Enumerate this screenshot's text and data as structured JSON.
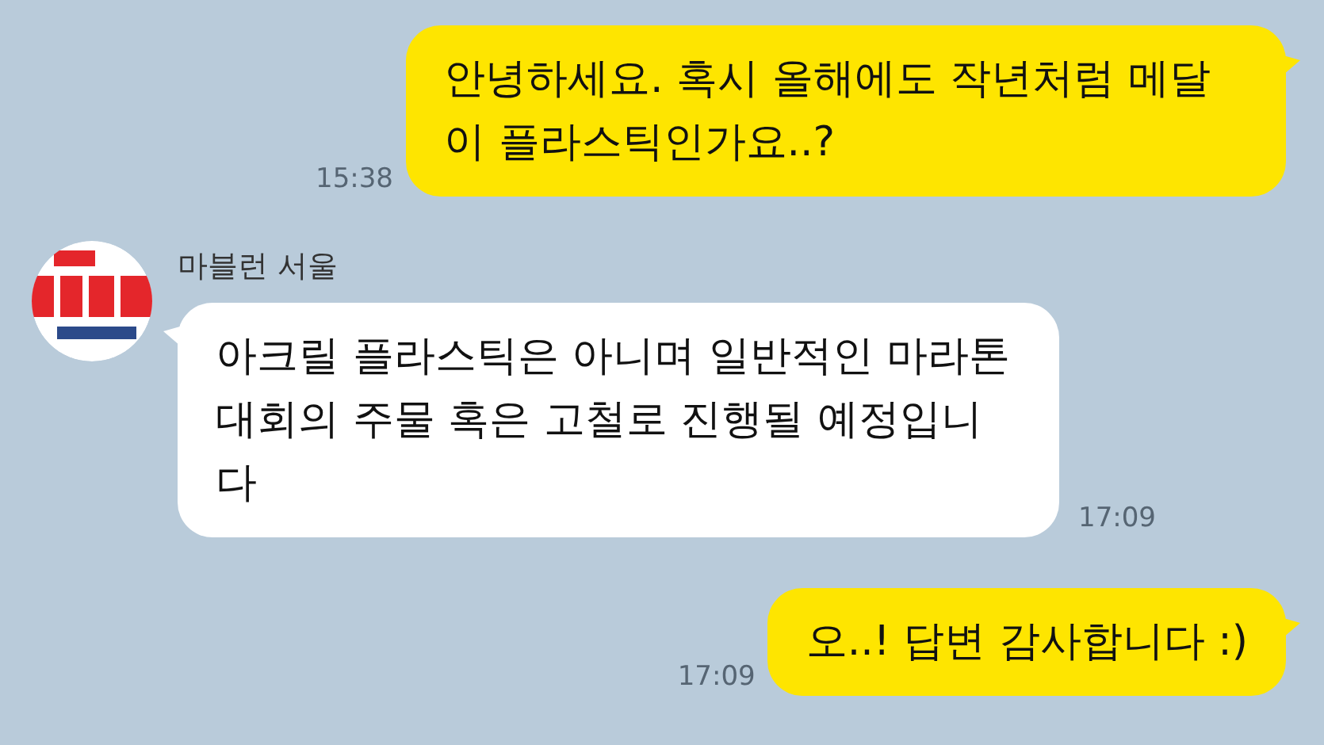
{
  "messages": [
    {
      "kind": "sent",
      "text": "안녕하세요. 혹시 올해에도 작년처럼 메달이 플라스틱인가요..?",
      "time": "15:38"
    },
    {
      "kind": "received",
      "sender": "마블런 서울",
      "text": "아크릴 플라스틱은 아니며 일반적인 마라톤 대회의 주물 혹은 고철로 진행될 예정입니다",
      "time": "17:09"
    },
    {
      "kind": "sent",
      "text": "오..! 답변 감사합니다 :)",
      "time": "17:09"
    }
  ]
}
